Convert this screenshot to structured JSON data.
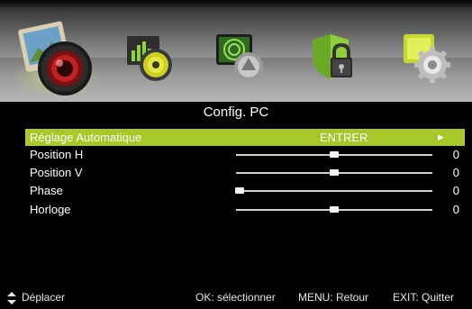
{
  "icons": [
    {
      "name": "picture-icon",
      "selected": true
    },
    {
      "name": "sound-icon",
      "selected": false
    },
    {
      "name": "channel-icon",
      "selected": false
    },
    {
      "name": "lock-icon",
      "selected": false
    },
    {
      "name": "setup-gear-icon",
      "selected": false
    }
  ],
  "menu": {
    "title": "Config. PC",
    "rows": [
      {
        "label": "Réglage Automatique",
        "value": "ENTRER",
        "arrow": "▶"
      },
      {
        "label": "Position H",
        "level": 0.5,
        "number": "0"
      },
      {
        "label": "Position V",
        "level": 0.5,
        "number": "0"
      },
      {
        "label": "Phase",
        "level": 0.02,
        "number": "0"
      },
      {
        "label": "Horloge",
        "level": 0.5,
        "number": "0"
      }
    ]
  },
  "footer": {
    "move_icon": "updown-arrows-icon",
    "move": "Déplacer",
    "ok": "OK: sélectionner",
    "menu": "MENU: Retour",
    "exit": "EXIT: Quitter"
  },
  "colors": {
    "highlight": "#a6c829",
    "background": "#000000"
  }
}
